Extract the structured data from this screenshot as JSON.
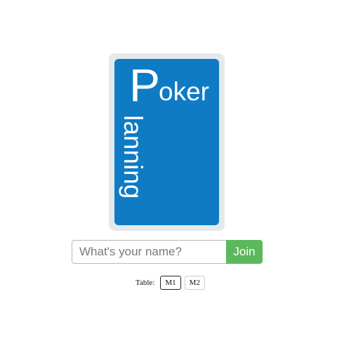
{
  "logo": {
    "letter_p": "P",
    "word_oker": "oker",
    "word_lanning": "lanning",
    "colors": {
      "card_border": "#e4e9ec",
      "card_fill": "#0f7bc4"
    }
  },
  "join_form": {
    "name_placeholder": "What's your name?",
    "name_value": "",
    "join_label": "Join",
    "join_color": "#5cb85c"
  },
  "table_selector": {
    "label": "Table:",
    "options": [
      {
        "label": "M1",
        "selected": true
      },
      {
        "label": "M2",
        "selected": false
      }
    ]
  }
}
